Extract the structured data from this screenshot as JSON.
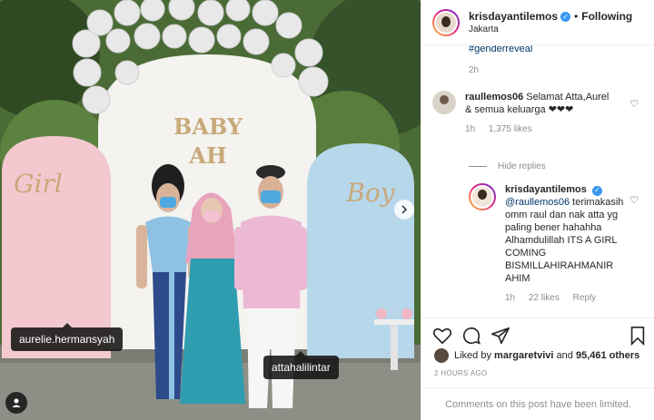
{
  "photo": {
    "sign_text_line1": "BABY",
    "sign_text_line2": "AH",
    "girl_sign": "Girl",
    "boy_sign": "Boy",
    "tags": [
      "aurelie.hermansyah",
      "attahalilintar"
    ]
  },
  "header": {
    "username": "krisdayantilemos",
    "separator": "•",
    "follow_status": "Following",
    "location": "Jakarta"
  },
  "comments": {
    "truncated_text": "#genderreveal",
    "truncated_time": "2h",
    "items": [
      {
        "username": "raullemos06",
        "text": "Selamat Atta,Aurel & semua keluarga ❤︎❤︎❤︎",
        "time": "1h",
        "likes": "1,375 likes"
      },
      {
        "username": "krisdayantilemos",
        "mention": "@raullemos06",
        "text": "terimakasih omm raul dan nak atta yg paling bener hahahha Alhamdulillah ITS A GIRL COMING BISMILLAHIRAHMANIR AHIM",
        "time": "1h",
        "likes": "22 likes",
        "reply_label": "Reply"
      }
    ],
    "hide_replies": "Hide replies"
  },
  "likes": {
    "prefix": "Liked by",
    "user": "margaretvivi",
    "conjunction": "and",
    "others": "95,461 others"
  },
  "post_time": "2 HOURS AGO",
  "comments_limited": "Comments on this post have been limited.",
  "icons": [
    "heart-icon",
    "comment-icon",
    "share-icon",
    "bookmark-icon",
    "next-arrow-icon",
    "user-tags-icon",
    "verified-icon"
  ],
  "colors": {
    "accent": "#3897f0",
    "link": "#00376b",
    "muted": "#8e8e8e"
  }
}
